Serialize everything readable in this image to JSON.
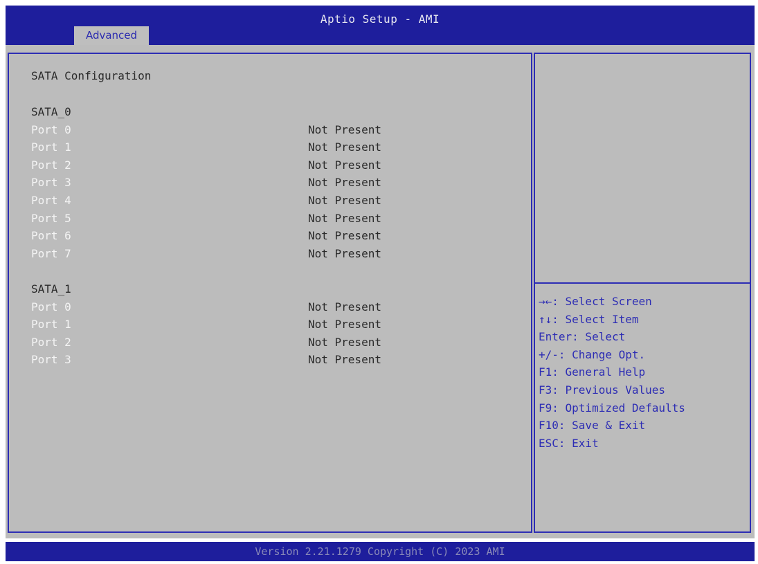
{
  "header": {
    "title": "Aptio Setup - AMI",
    "tabs": [
      {
        "label": "Advanced",
        "active": true
      }
    ]
  },
  "main": {
    "title": "SATA Configuration",
    "groups": [
      {
        "name": "SATA_0",
        "ports": [
          {
            "label": "Port 0",
            "value": "Not Present"
          },
          {
            "label": "Port 1",
            "value": "Not Present"
          },
          {
            "label": "Port 2",
            "value": "Not Present"
          },
          {
            "label": "Port 3",
            "value": "Not Present"
          },
          {
            "label": "Port 4",
            "value": "Not Present"
          },
          {
            "label": "Port 5",
            "value": "Not Present"
          },
          {
            "label": "Port 6",
            "value": "Not Present"
          },
          {
            "label": "Port 7",
            "value": "Not Present"
          }
        ]
      },
      {
        "name": "SATA_1",
        "ports": [
          {
            "label": "Port 0",
            "value": "Not Present"
          },
          {
            "label": "Port 1",
            "value": "Not Present"
          },
          {
            "label": "Port 2",
            "value": "Not Present"
          },
          {
            "label": "Port 3",
            "value": "Not Present"
          }
        ]
      }
    ]
  },
  "help": {
    "keys": [
      "→←: Select Screen",
      "↑↓: Select Item",
      "Enter: Select",
      "+/-: Change Opt.",
      "F1: General Help",
      "F3: Previous Values",
      "F9: Optimized Defaults",
      "F10: Save & Exit",
      "ESC: Exit"
    ]
  },
  "footer": {
    "text": "Version 2.21.1279 Copyright (C) 2023 AMI"
  },
  "colors": {
    "title_bar": "#1e1e9c",
    "panel_background": "#bcbcbc",
    "border": "#2d2db4",
    "help_text": "#2d2db4",
    "port_label": "#f4f4f4",
    "value_text": "#2a2a2a"
  }
}
